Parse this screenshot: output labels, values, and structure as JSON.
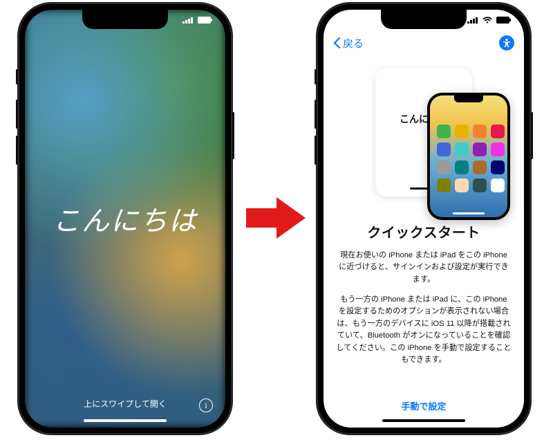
{
  "accent": "#0a7aff",
  "arrow_color": "#e11b1b",
  "left_phone": {
    "hello": "こんにちは",
    "swipe_hint": "上にスワイプして開く",
    "info_glyph": "i"
  },
  "right_phone": {
    "back_label": "戻る",
    "illustration_label": "こんにちは",
    "title": "クイックスタート",
    "paragraph1": "現在お使いの iPhone または iPad をこの iPhone に近づけると、サインインおよび設定が実行できます。",
    "paragraph2": "もう一方の iPhone または iPad に、この iPhone を設定するためのオプションが表示されない場合は、もう一方のデバイスに iOS 11 以降が搭載されていて、Bluetooth がオンになっていることを確認してください。この iPhone を手動で設定することもできます。",
    "manual_link": "手動で設定",
    "mini_apps": [
      "#3cb44b",
      "#e6b400",
      "#f58231",
      "#e6194b",
      "#4363d8",
      "#46c8c8",
      "#911eb4",
      "#f032e6",
      "#9a9a9a",
      "#008080",
      "#aa6e28",
      "#000075",
      "#808000",
      "#ffd8b1",
      "#2f4f4f",
      "#ffffff"
    ]
  }
}
